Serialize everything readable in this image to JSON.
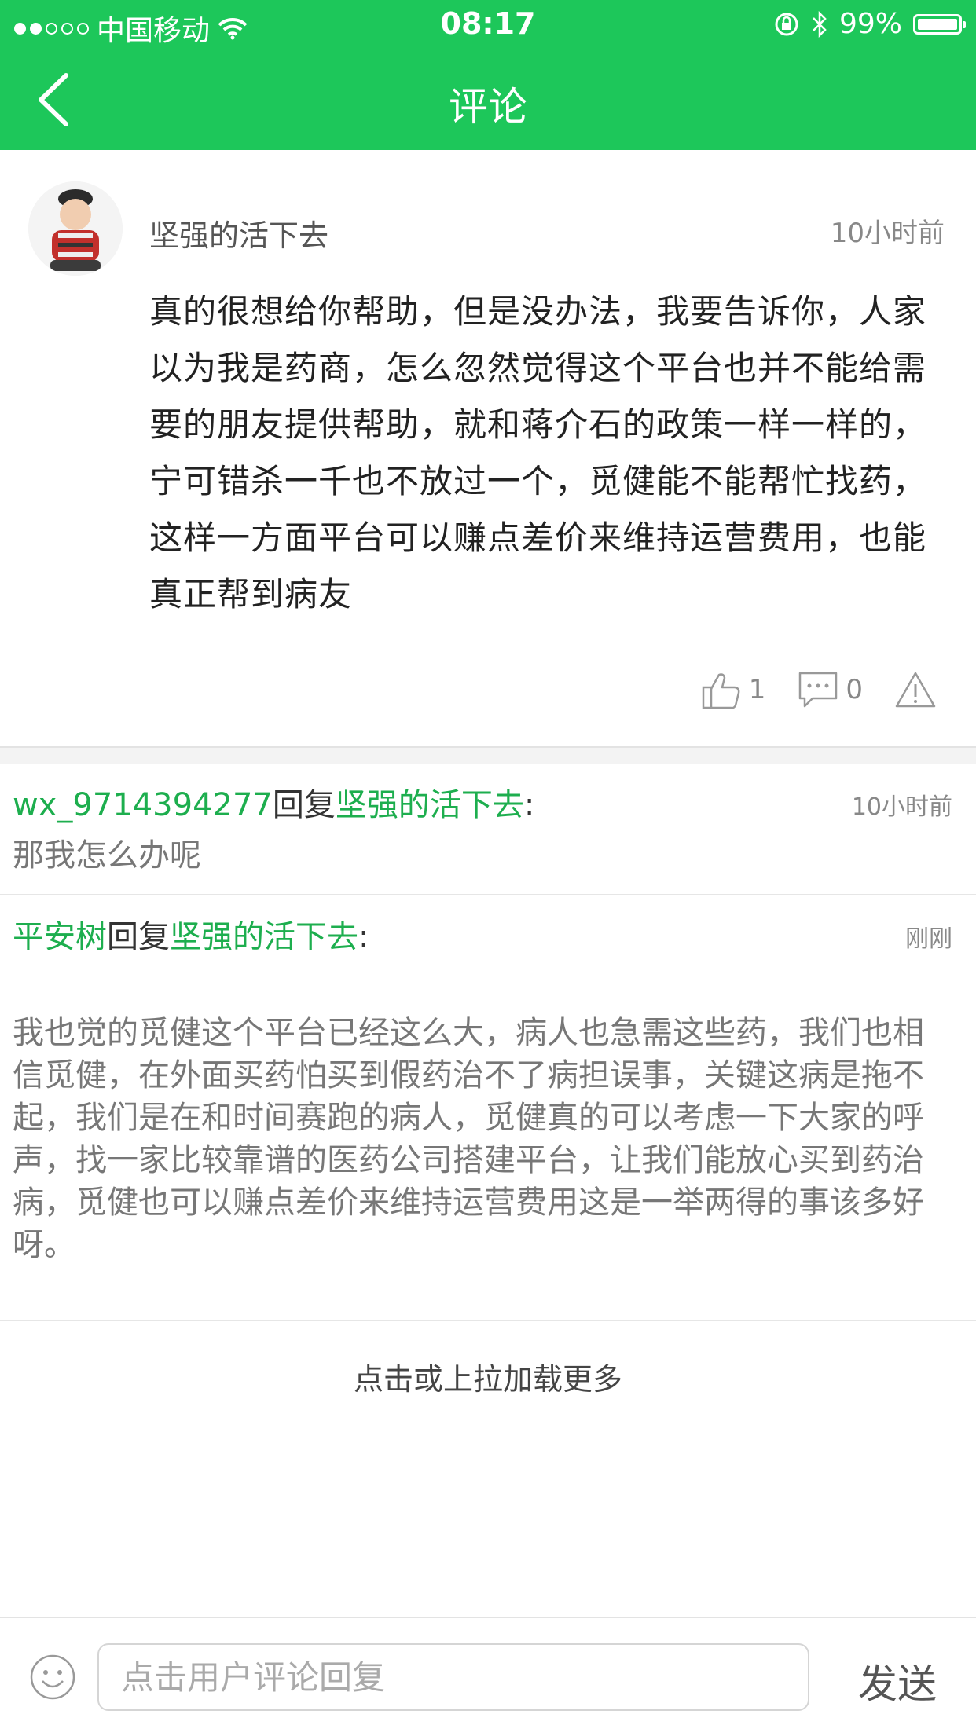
{
  "status_bar": {
    "carrier": "中国移动",
    "time": "08:17",
    "battery": "99%",
    "battery_level": 0.99,
    "signal_dots_filled": 2,
    "signal_dots_total": 5
  },
  "header": {
    "title": "评论",
    "background_color": "#1dc75a"
  },
  "comment": {
    "username": "坚强的活下去",
    "time": "10小时前",
    "text": "真的很想给你帮助，但是没办法，我要告诉你，人家以为我是药商，怎么忽然觉得这个平台也并不能给需要的朋友提供帮助，就和蒋介石的政策一样一样的，宁可错杀一千也不放过一个，觅健能不能帮忙找药，这样一方面平台可以赚点差价来维持运营费用，也能真正帮到病友",
    "likes": "1",
    "comments": "0"
  },
  "replies": [
    {
      "user": "wx_9714394277",
      "reply_word": "回复",
      "target": "坚强的活下去",
      "colon": ":",
      "time": "10小时前",
      "text": "那我怎么办呢"
    },
    {
      "user": "平安树",
      "reply_word": "回复",
      "target": "坚强的活下去",
      "colon": ":",
      "time": "刚刚",
      "text": "我也觉的觅健这个平台已经这么大，病人也急需这些药，我们也相信觅健，在外面买药怕买到假药治不了病担误事，关键这病是拖不起，我们是在和时间赛跑的病人，觅健真的可以考虑一下大家的呼声，找一家比较靠谱的医药公司搭建平台，让我们能放心买到药治病，觅健也可以赚点差价来维持运营费用这是一举两得的事该多好呀。"
    }
  ],
  "load_more": "点击或上拉加载更多",
  "bottom_bar": {
    "placeholder": "点击用户评论回复",
    "send_label": "发送"
  },
  "colors": {
    "accent_green": "#1dc75a",
    "username_green": "#1dae4e"
  },
  "icons": [
    "back-chevron-icon",
    "wifi-icon",
    "rotation-lock-icon",
    "bluetooth-icon",
    "battery-icon",
    "thumbs-up-icon",
    "comment-bubble-icon",
    "warning-icon",
    "emoji-icon"
  ]
}
